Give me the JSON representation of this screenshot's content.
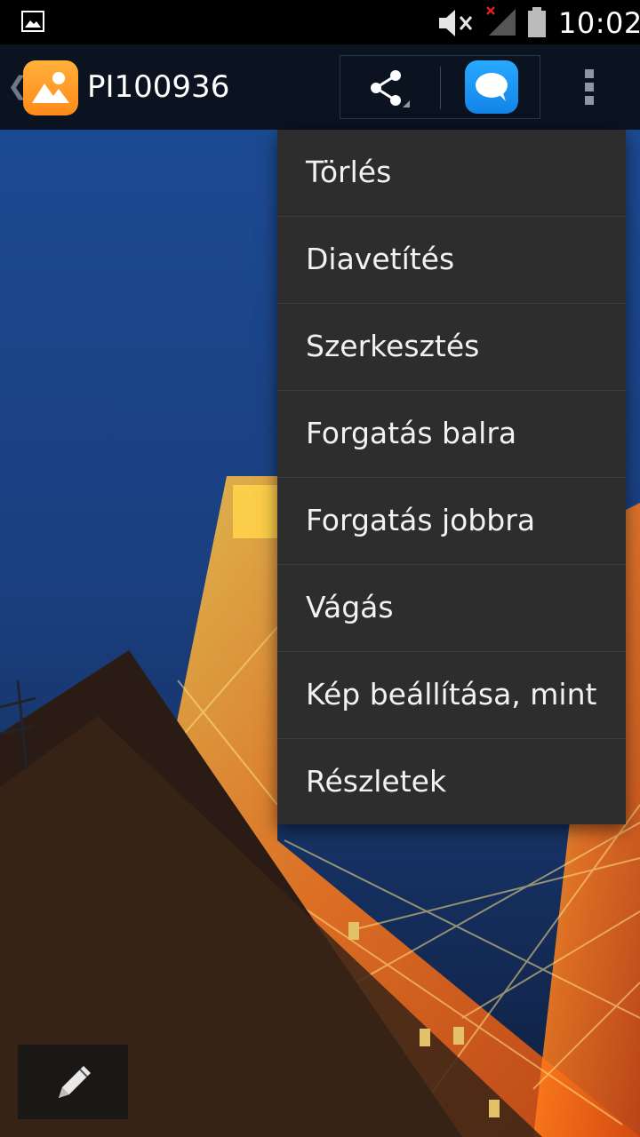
{
  "status_bar": {
    "time": "10:02",
    "icons": [
      "gallery-notification-icon",
      "mute-icon",
      "no-signal-icon",
      "battery-icon"
    ]
  },
  "action_bar": {
    "back_glyph": "❮",
    "title": "PI100936",
    "icons": [
      "gallery-app-icon",
      "share-icon",
      "messenger-icon",
      "overflow-menu-icon"
    ]
  },
  "menu": {
    "items": [
      {
        "label": "Törlés"
      },
      {
        "label": "Diavetítés"
      },
      {
        "label": "Szerkesztés"
      },
      {
        "label": "Forgatás balra"
      },
      {
        "label": "Forgatás jobbra"
      },
      {
        "label": "Vágás"
      },
      {
        "label": "Kép beállítása, mint"
      },
      {
        "label": "Részletek"
      }
    ]
  },
  "edit_button": {
    "icon": "pencil-icon"
  },
  "colors": {
    "menu_bg": "#2d2d2d",
    "action_bar_bg": "#0b1321",
    "app_icon": "#ff9a22",
    "messenger_icon": "#1e97f4",
    "sky": "#1c4a92",
    "tower": "#ff7a1a"
  }
}
